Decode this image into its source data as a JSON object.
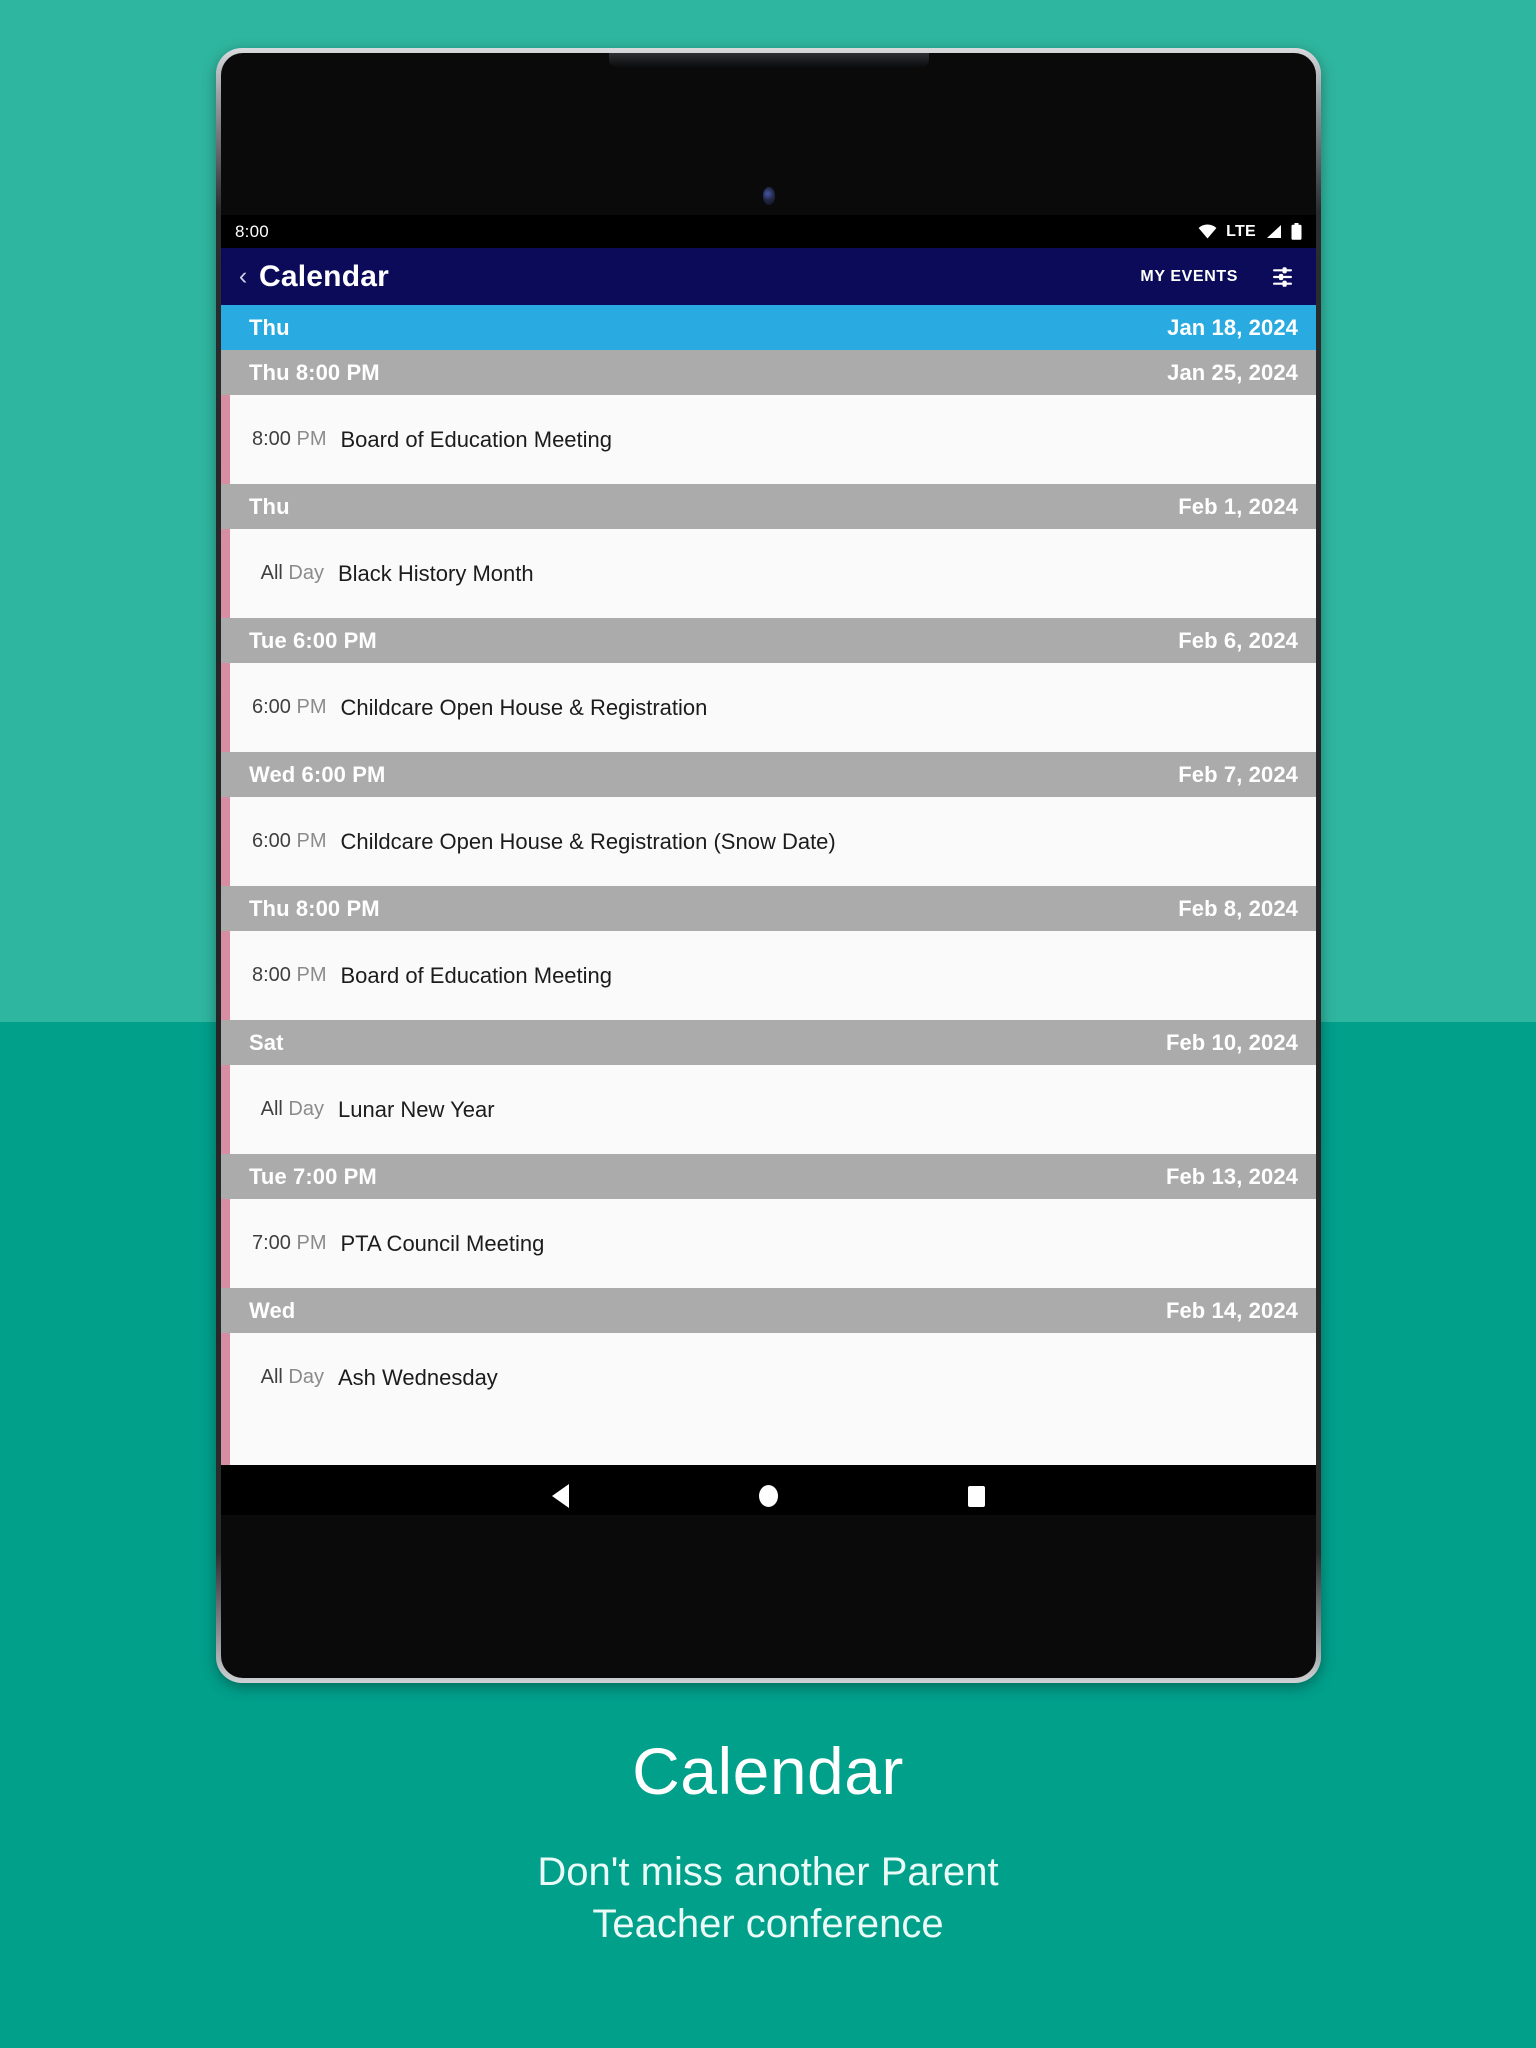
{
  "background": {
    "top_color": "#2FB6A0",
    "bottom_color": "#00A08B"
  },
  "status_bar": {
    "time": "8:00",
    "network_label": "LTE",
    "icons": [
      "wifi-icon",
      "lte-label",
      "cellular-signal-icon",
      "battery-icon"
    ]
  },
  "app_bar": {
    "back_icon": "‹",
    "title": "Calendar",
    "my_events_label": "MY EVENTS",
    "tune_icon": "tune-icon",
    "background_color": "#0B0B59"
  },
  "list": {
    "today_header_color": "#29ABE2",
    "header_color": "#ABABAB",
    "event_accent_color": "#D78DA2",
    "sections": [
      {
        "header_left": "Thu",
        "header_right": "Jan 18, 2024",
        "is_today": true,
        "events": []
      },
      {
        "header_left": "Thu 8:00 PM",
        "header_right": "Jan 25, 2024",
        "is_today": false,
        "events": [
          {
            "time": "8:00",
            "meridiem": "PM",
            "title": "Board of Education Meeting"
          }
        ]
      },
      {
        "header_left": "Thu",
        "header_right": "Feb 1, 2024",
        "is_today": false,
        "events": [
          {
            "time": "All",
            "meridiem": "Day",
            "title": "Black History Month"
          }
        ]
      },
      {
        "header_left": "Tue 6:00 PM",
        "header_right": "Feb 6, 2024",
        "is_today": false,
        "events": [
          {
            "time": "6:00",
            "meridiem": "PM",
            "title": "Childcare Open House & Registration"
          }
        ]
      },
      {
        "header_left": "Wed 6:00 PM",
        "header_right": "Feb 7, 2024",
        "is_today": false,
        "events": [
          {
            "time": "6:00",
            "meridiem": "PM",
            "title": "Childcare Open House & Registration (Snow Date)"
          }
        ]
      },
      {
        "header_left": "Thu 8:00 PM",
        "header_right": "Feb 8, 2024",
        "is_today": false,
        "events": [
          {
            "time": "8:00",
            "meridiem": "PM",
            "title": "Board of Education Meeting"
          }
        ]
      },
      {
        "header_left": "Sat",
        "header_right": "Feb 10, 2024",
        "is_today": false,
        "events": [
          {
            "time": "All",
            "meridiem": "Day",
            "title": "Lunar New Year"
          }
        ]
      },
      {
        "header_left": "Tue 7:00 PM",
        "header_right": "Feb 13, 2024",
        "is_today": false,
        "events": [
          {
            "time": "7:00",
            "meridiem": "PM",
            "title": "PTA Council Meeting"
          }
        ]
      },
      {
        "header_left": "Wed",
        "header_right": "Feb 14, 2024",
        "is_today": false,
        "events": [
          {
            "time": "All",
            "meridiem": "Day",
            "title": "Ash Wednesday"
          }
        ]
      }
    ]
  },
  "nav_bar": {
    "buttons": [
      "back-triangle-icon",
      "home-circle-icon",
      "recents-square-icon"
    ]
  },
  "caption": {
    "title": "Calendar",
    "subtitle_line1": "Don't miss another Parent",
    "subtitle_line2": "Teacher conference"
  }
}
